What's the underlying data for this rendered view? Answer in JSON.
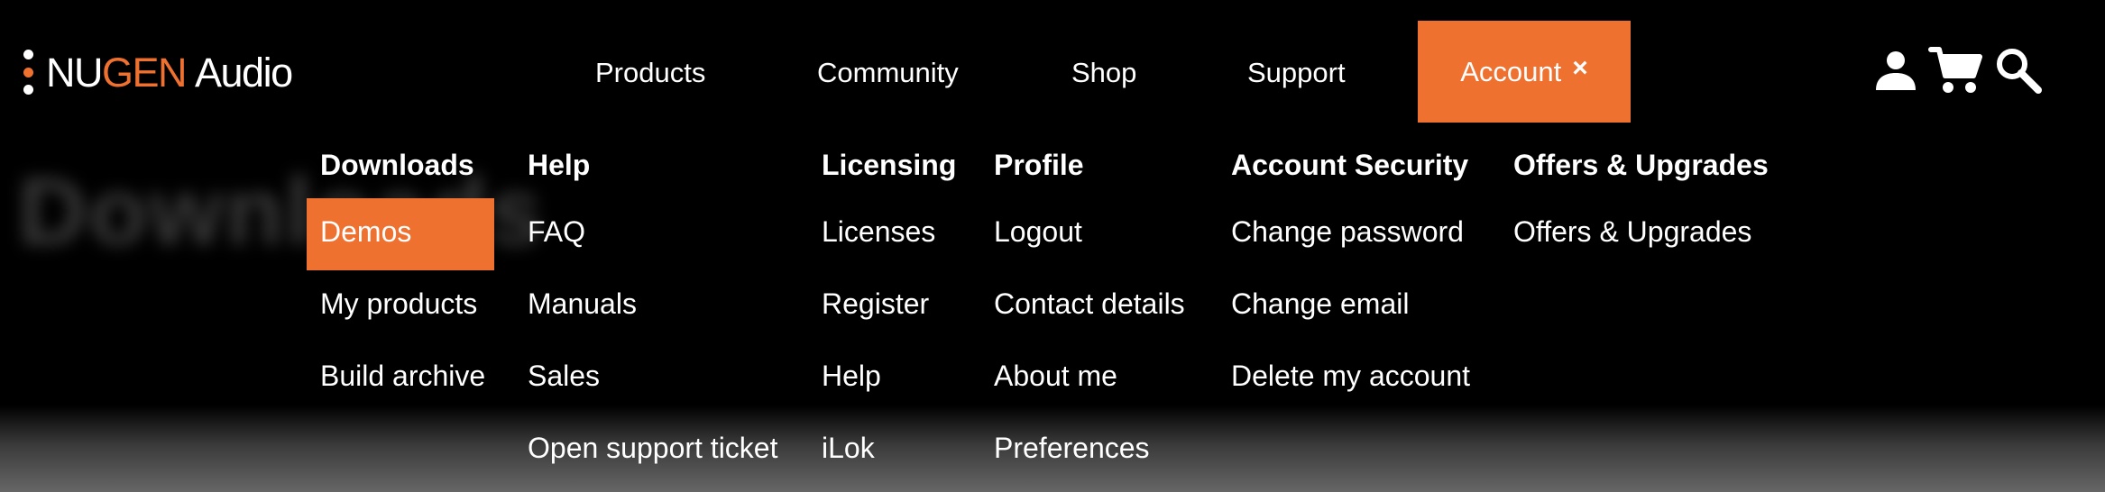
{
  "brand": {
    "name_part1": "NU",
    "name_part2": "GEN",
    "name_part3": "Audio",
    "accent_color": "#ee7130"
  },
  "background_heading": "Downloads",
  "nav": {
    "items": [
      {
        "label": "Products"
      },
      {
        "label": "Community"
      },
      {
        "label": "Shop"
      },
      {
        "label": "Support"
      }
    ],
    "active": {
      "label": "Account",
      "close_glyph": "×"
    }
  },
  "header_icons": [
    "user-icon",
    "cart-icon",
    "search-icon"
  ],
  "mega_menu": {
    "columns": [
      {
        "heading": "Downloads",
        "items": [
          "Demos",
          "My products",
          "Build archive"
        ],
        "active_item": "Demos"
      },
      {
        "heading": "Help",
        "items": [
          "FAQ",
          "Manuals",
          "Sales",
          "Open support ticket"
        ]
      },
      {
        "heading": "Licensing",
        "items": [
          "Licenses",
          "Register",
          "Help",
          "iLok"
        ]
      },
      {
        "heading": "Profile",
        "items": [
          "Logout",
          "Contact details",
          "About me",
          "Preferences"
        ]
      },
      {
        "heading": "Account Security",
        "items": [
          "Change password",
          "Change email",
          "Delete my account"
        ]
      },
      {
        "heading": "Offers & Upgrades",
        "items": [
          "Offers & Upgrades"
        ]
      }
    ]
  }
}
